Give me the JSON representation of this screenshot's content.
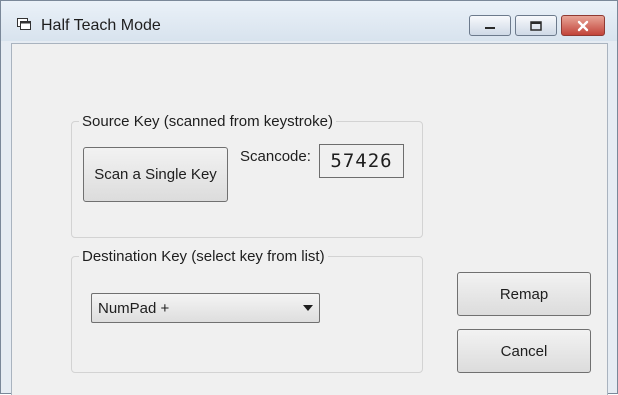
{
  "window": {
    "title": "Half Teach Mode",
    "icons": {
      "app": "window-icon",
      "minimize": "minimize-icon",
      "maximize": "maximize-icon",
      "close": "close-icon"
    },
    "colors": {
      "close_button": "#c84a3c",
      "title_bar": "#dfe8f1"
    }
  },
  "source_group": {
    "legend": "Source Key (scanned from keystroke)",
    "scan_button_label": "Scan a Single Key",
    "scancode_label": "Scancode:",
    "scancode_value": "57426"
  },
  "destination_group": {
    "legend": "Destination Key (select key from list)",
    "selected_key": "NumPad +",
    "dropdown_icon": "chevron-down-icon"
  },
  "actions": {
    "remap_label": "Remap",
    "cancel_label": "Cancel"
  }
}
